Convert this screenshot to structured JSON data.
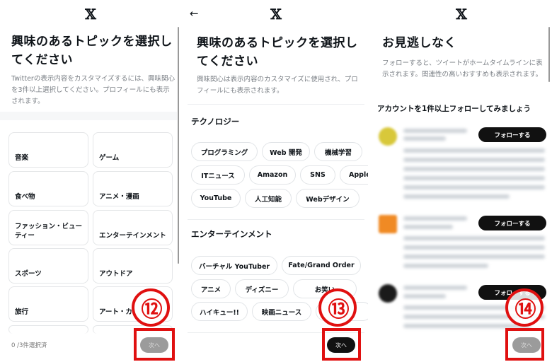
{
  "panel1": {
    "title": "興味のあるトピックを選択してください",
    "description": "Twitterの表示内容をカスタマイズするには、興味関心を3件以上選択してください。プロフィールにも表示されます。",
    "topics": [
      "音楽",
      "ゲーム",
      "食べ物",
      "アニメ・漫画",
      "ファッション・ビューティー",
      "エンターテインメント",
      "スポーツ",
      "アウトドア",
      "旅行",
      "アート・カ"
    ],
    "selected_count": "0 /3件選択済",
    "next_label": "次へ",
    "annotation": "⑫"
  },
  "panel2": {
    "title": "興味のあるトピックを選択してください",
    "description": "興味関心は表示内容のカスタマイズに使用され、プロフィールにも表示されます。",
    "sections": [
      {
        "heading": "テクノロジー",
        "rows": [
          [
            "プログラミング",
            "Web 開発",
            "機械学習"
          ],
          [
            "ITニュース",
            "Amazon",
            "SNS",
            "Apple"
          ],
          [
            "YouTube",
            "人工知能",
            "Webデザイン"
          ]
        ]
      },
      {
        "heading": "エンターテインメント",
        "rows": [
          [
            "バーチャル YouTuber",
            "Fate/Grand Order"
          ],
          [
            "アニメ",
            "ディズニー",
            "お笑い"
          ],
          [
            "ハイキュー!!",
            "映画ニュース"
          ]
        ]
      }
    ],
    "next_label": "次へ",
    "annotation": "⑬"
  },
  "panel3": {
    "title": "お見逃しなく",
    "description": "フォローすると、ツイートがホームタイムラインに表示されます。関連性の高いおすすめも表示されます。",
    "heading": "アカウントを1件以上フォローしてみましょう",
    "follow_label": "フォローする",
    "avatar_colors": [
      "#d8c83a",
      "#f08a24",
      "#1a1a1a"
    ],
    "next_label": "次へ",
    "annotation": "⑭"
  },
  "colors": {
    "annotation": "#e01010",
    "disabled": "#9b9b9b",
    "primary": "#0f1419"
  }
}
